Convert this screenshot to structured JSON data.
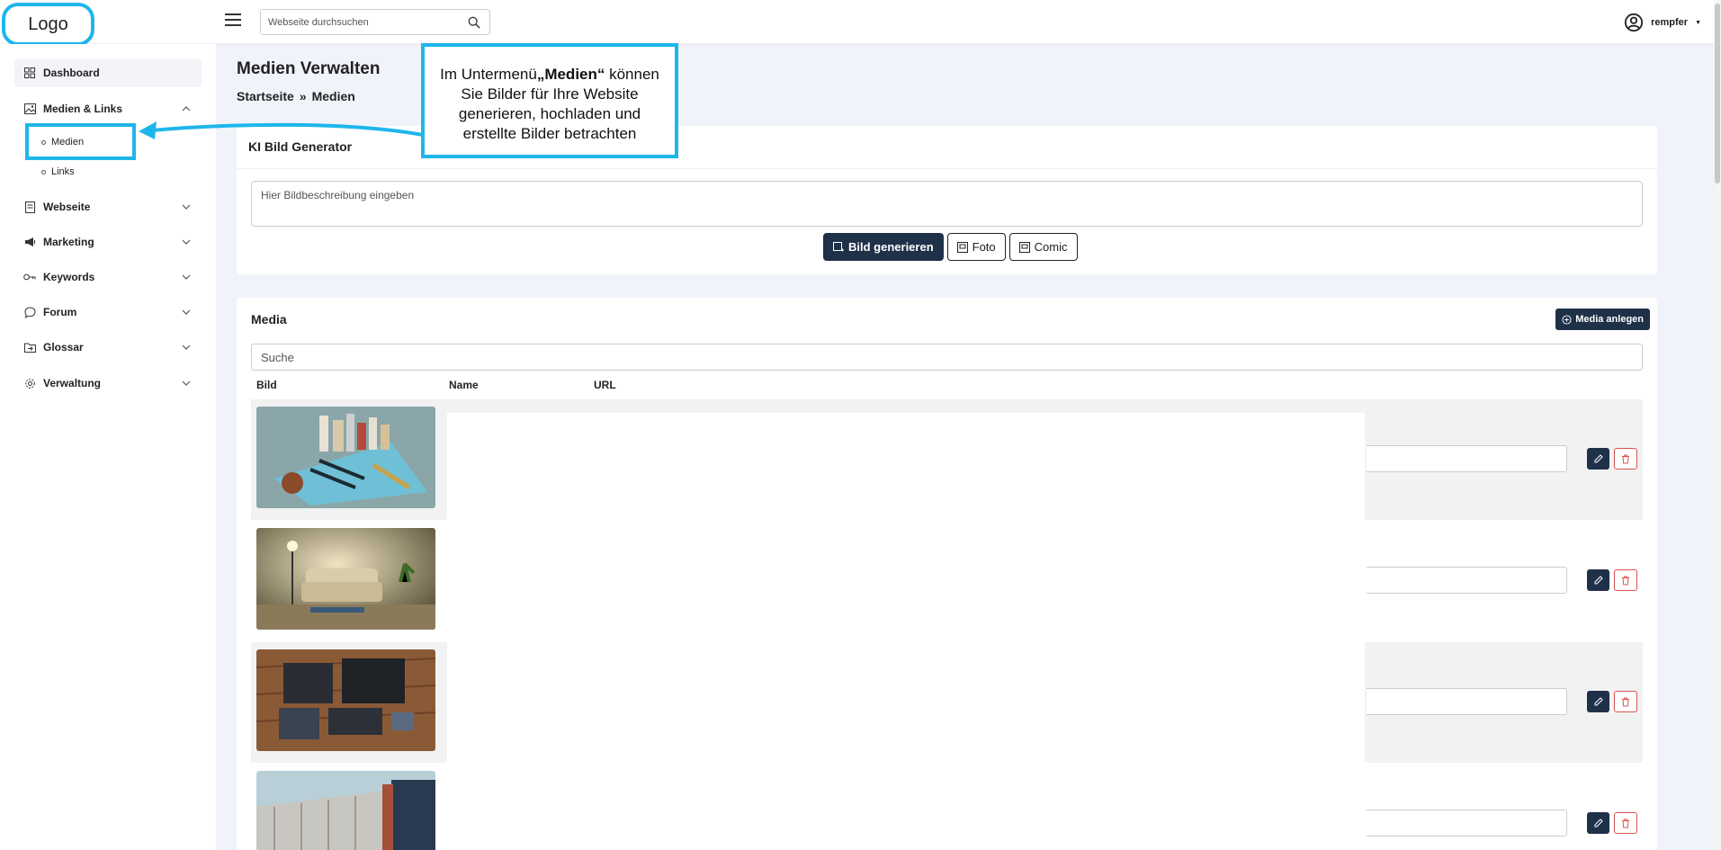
{
  "header": {
    "logo_text": "Logo",
    "search_placeholder": "Webseite durchsuchen",
    "username": "rempfer"
  },
  "sidebar": {
    "items": [
      {
        "label": "Dashboard",
        "icon": "grid-icon"
      },
      {
        "label": "Medien & Links",
        "icon": "image-icon",
        "expanded": true
      },
      {
        "label": "Webseite",
        "icon": "page-icon"
      },
      {
        "label": "Marketing",
        "icon": "megaphone-icon"
      },
      {
        "label": "Keywords",
        "icon": "key-icon"
      },
      {
        "label": "Forum",
        "icon": "chat-icon"
      },
      {
        "label": "Glossar",
        "icon": "folder-icon"
      },
      {
        "label": "Verwaltung",
        "icon": "gear-icon"
      }
    ],
    "subitems": [
      {
        "label": "Medien",
        "active": true
      },
      {
        "label": "Links"
      }
    ]
  },
  "page": {
    "title": "Medien Verwalten",
    "breadcrumb_home": "Startseite",
    "breadcrumb_sep": "»",
    "breadcrumb_current": "Medien"
  },
  "callout": {
    "line1_prefix": "Im Untermenü",
    "line1_bold": "„Medien“",
    "line1_suffix": " können",
    "line2": "Sie Bilder für Ihre Website",
    "line3": "generieren, hochladen und",
    "line4": "erstellte Bilder betrachten"
  },
  "generator": {
    "title": "KI Bild Generator",
    "placeholder": "Hier Bildbeschreibung eingeben",
    "btn_generate": "Bild generieren",
    "btn_foto": "Foto",
    "btn_comic": "Comic"
  },
  "media": {
    "title": "Media",
    "add_label": "Media anlegen",
    "search_placeholder": "Suche",
    "columns": [
      "Bild",
      "Name",
      "URL"
    ],
    "rows": [
      {
        "image": "tools-on-table"
      },
      {
        "image": "living-room-sofa"
      },
      {
        "image": "clothes-on-wood-floor"
      },
      {
        "image": "building-facade"
      }
    ]
  },
  "colors": {
    "accent": "#1eb6ea",
    "dark_button": "#1f3049",
    "delete": "#d9534f"
  }
}
